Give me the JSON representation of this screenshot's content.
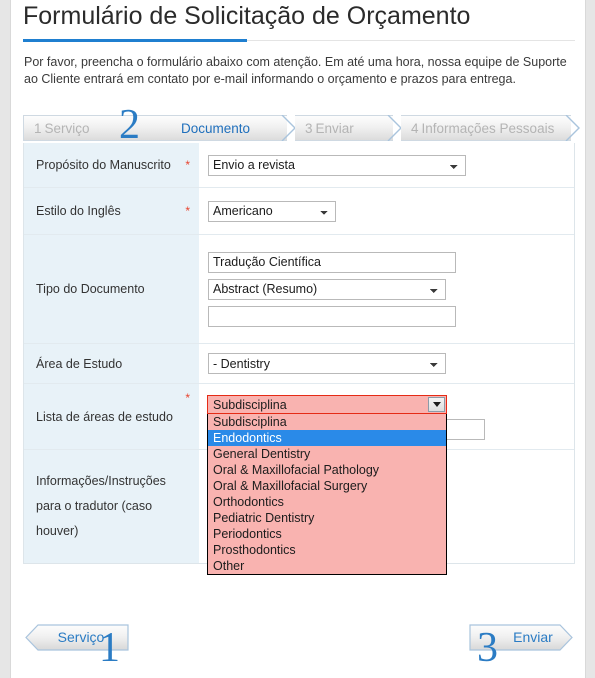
{
  "page": {
    "title": "Formulário de Solicitação de Orçamento",
    "intro": "Por favor, preencha o formulário abaixo com atenção. Em até uma hora, nossa equipe de Suporte ao Cliente entrará em contato por e-mail informando o orçamento e prazos para entrega.",
    "accent_color": "#1f7fd0",
    "label_bg_color": "#e8f2f8",
    "error_bg_color": "#f9b3b0",
    "error_border_color": "#e52b16",
    "highlight_color": "#2a8ae8"
  },
  "steps": {
    "active_index": 1,
    "big_number": "2",
    "items": [
      {
        "number": "1",
        "label": "Serviço",
        "active": false
      },
      {
        "number": "2",
        "label": "Documento",
        "active": true
      },
      {
        "number": "3",
        "label": "Enviar",
        "active": false
      },
      {
        "number": "4",
        "label": "Informações Pessoais",
        "active": false
      }
    ]
  },
  "form": {
    "required_mark": "*",
    "rows": [
      {
        "label": "Propósito do Manuscrito",
        "required": true,
        "select_value": "Envio a revista"
      },
      {
        "label": "Estilo do Inglês",
        "required": true,
        "select_value": "Americano"
      },
      {
        "label": "Tipo do Documento",
        "required": false,
        "text_value": "Tradução Científica",
        "select_value": "Abstract (Resumo)",
        "extra_value": "",
        "extra_placeholder": ""
      },
      {
        "label": "Área de Estudo",
        "required": false,
        "select_value": "- Dentistry"
      },
      {
        "label": "Lista de áreas de estudo",
        "required": true,
        "text_value": "",
        "text_placeholder": ""
      },
      {
        "label_line1": "Informações/Instruções",
        "label_line2": "para o tradutor (caso",
        "label_line3": "houver)",
        "required": false,
        "textarea_value": "",
        "textarea_placeholder": ""
      }
    ]
  },
  "subdiscipline_dropdown": {
    "open": true,
    "selected_display": "Subdisciplina",
    "highlighted": "Endodontics",
    "options": [
      "Subdisciplina",
      "Endodontics",
      "General Dentistry",
      "Oral & Maxillofacial Pathology",
      "Oral & Maxillofacial Surgery",
      "Orthodontics",
      "Pediatric Dentistry",
      "Periodontics",
      "Prosthodontics",
      "Other"
    ]
  },
  "footer": {
    "prev": {
      "label": "Serviço",
      "number": "1"
    },
    "next": {
      "label": "Enviar",
      "number": "3"
    }
  }
}
